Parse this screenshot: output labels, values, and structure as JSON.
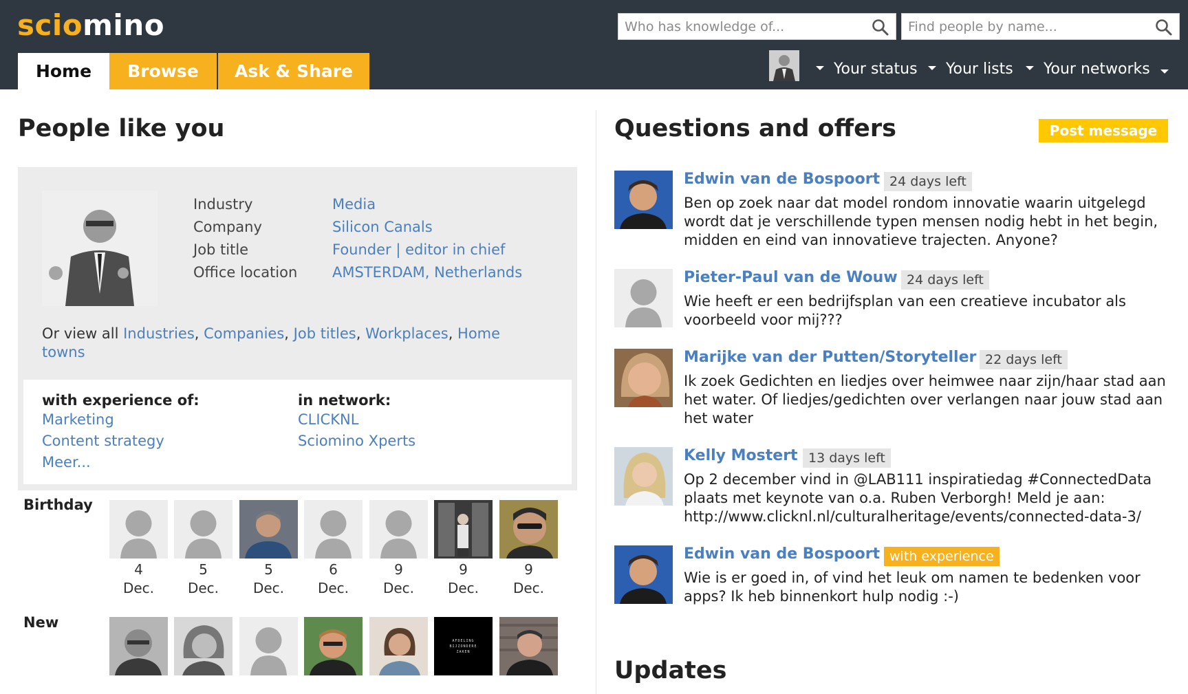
{
  "header": {
    "logo_part1": "scio",
    "logo_part2": "mino",
    "search_knowledge_placeholder": "Who has knowledge of...",
    "search_people_placeholder": "Find people by name...",
    "tabs": [
      {
        "label": "Home",
        "active": true
      },
      {
        "label": "Browse",
        "active": false
      },
      {
        "label": "Ask & Share",
        "active": false
      }
    ],
    "menus": {
      "status": "Your status",
      "lists": "Your lists",
      "networks": "Your networks"
    }
  },
  "people_like_you": {
    "title": "People like you",
    "profile_fields": [
      {
        "label": "Industry",
        "value": "Media"
      },
      {
        "label": "Company",
        "value": "Silicon Canals"
      },
      {
        "label": "Job title",
        "value": "Founder | editor in chief"
      },
      {
        "label": "Office location",
        "value": "AMSTERDAM, Netherlands"
      }
    ],
    "view_all_prefix": "Or view all",
    "view_all_links": [
      "Industries",
      "Companies",
      "Job titles",
      "Workplaces",
      "Home towns"
    ],
    "experience_heading": "with experience of:",
    "experience_items": [
      "Marketing",
      "Content strategy",
      "Meer..."
    ],
    "network_heading": "in network:",
    "network_items": [
      "CLICKNL",
      "Sciomino Xperts"
    ],
    "birthday_label": "Birthday",
    "birthdays": [
      {
        "day": "4",
        "month": "Dec."
      },
      {
        "day": "5",
        "month": "Dec."
      },
      {
        "day": "5",
        "month": "Dec."
      },
      {
        "day": "6",
        "month": "Dec."
      },
      {
        "day": "9",
        "month": "Dec."
      },
      {
        "day": "9",
        "month": "Dec."
      },
      {
        "day": "9",
        "month": "Dec."
      }
    ],
    "new_label": "New",
    "new_sign_text": "AFDELING BIJZONDERE ZAKEN"
  },
  "questions": {
    "title": "Questions and offers",
    "post_button": "Post message",
    "items": [
      {
        "name": "Edwin van de Bospoort",
        "badge": "24 days left",
        "text": "Ben op zoek naar dat model rondom innovatie waarin uitgelegd wordt dat je verschillende typen mensen nodig hebt in het begin, midden en eind van innovatieve trajecten. Anyone?"
      },
      {
        "name": "Pieter-Paul van de Wouw",
        "badge": "24 days left",
        "text": "Wie heeft er een bedrijfsplan van een creatieve incubator als voorbeeld voor mij???"
      },
      {
        "name": "Marijke van der Putten/Storyteller",
        "badge": "22 days left",
        "text": "Ik zoek Gedichten en liedjes over heimwee naar zijn/haar stad aan het water. Of liedjes/gedichten over verlangen naar jouw stad aan het water"
      },
      {
        "name": "Kelly Mostert",
        "badge": "13 days left",
        "text": "Op 2 december vind in @LAB111 inspiratiedag #ConnectedData plaats met keynote van o.a. Ruben Verborgh! Meld je aan: http://www.clicknl.nl/culturalheritage/events/connected-data-3/"
      },
      {
        "name": "Edwin van de Bospoort",
        "badge": "with experience",
        "text": "Wie is er goed in, of vind het leuk om namen te bedenken voor apps? Ik heb binnenkort hulp nodig :-)"
      }
    ]
  },
  "updates": {
    "title": "Updates"
  },
  "colors": {
    "header_bg": "#2f3840",
    "accent_orange": "#f7b11e",
    "post_yellow": "#ffc800",
    "link_blue": "#4a7fc0"
  }
}
